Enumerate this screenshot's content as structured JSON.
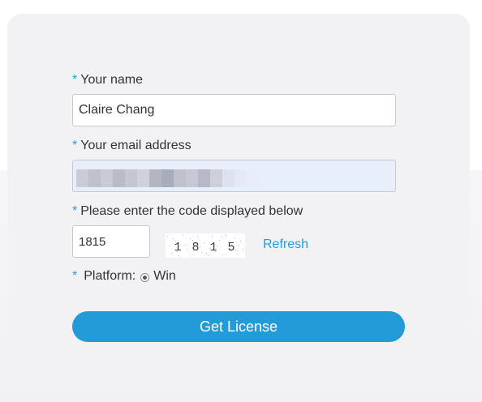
{
  "form": {
    "required_mark": "*",
    "name": {
      "label": "Your name",
      "value": "Claire Chang"
    },
    "email": {
      "label": "Your email address",
      "value": "",
      "redacted": true
    },
    "code": {
      "label": "Please enter the code displayed below",
      "value": "1815",
      "captcha_text": "1 8 1 5",
      "refresh_label": "Refresh"
    },
    "platform": {
      "label": "Platform:",
      "option": "Win",
      "selected": true
    },
    "submit_label": "Get License"
  },
  "colors": {
    "accent": "#229bd8",
    "required": "#2b9bd6",
    "card_bg": "#f2f2f5",
    "autofill_bg": "#e8effb"
  }
}
